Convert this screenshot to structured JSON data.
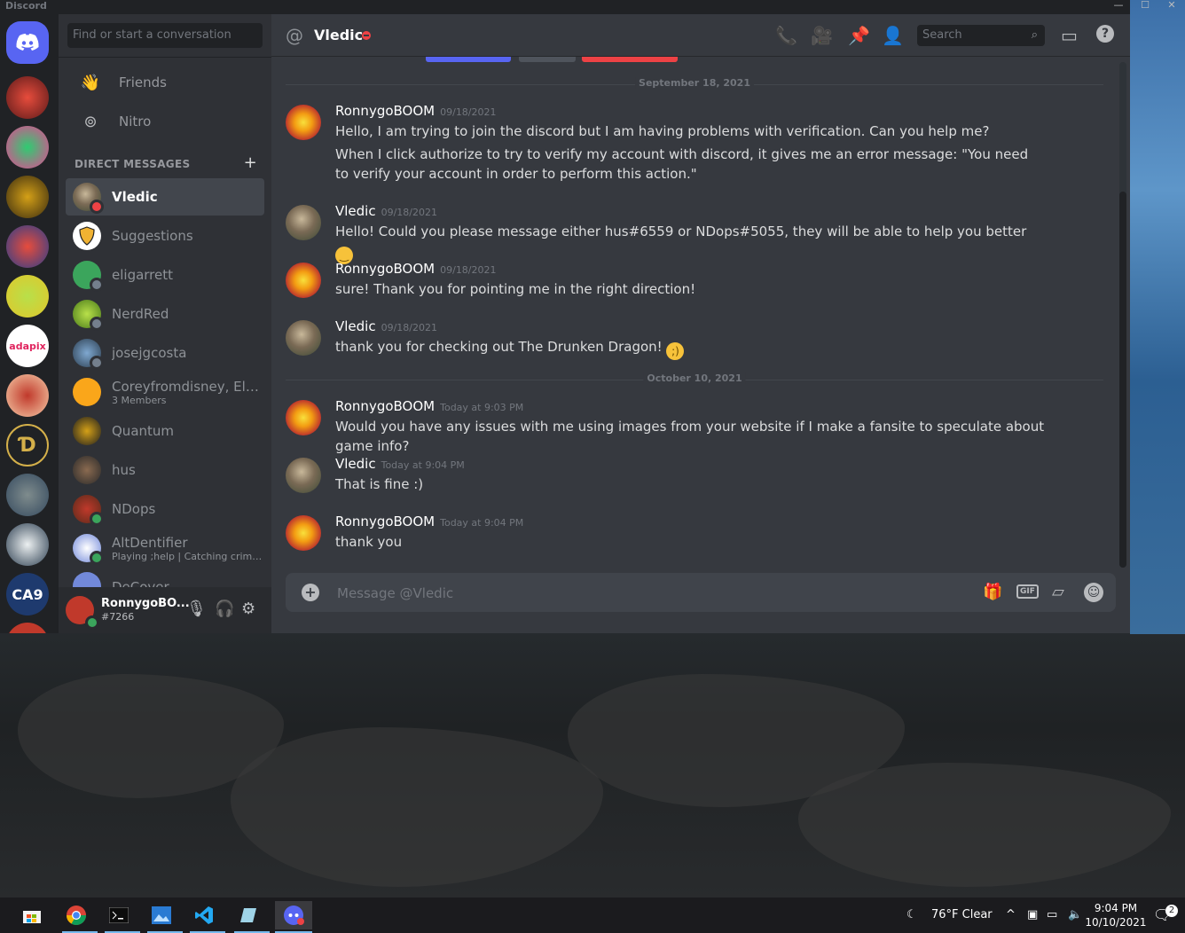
{
  "app": {
    "title": "Discord"
  },
  "window_controls": {
    "minimize": "—",
    "maximize": "☐",
    "close": "✕"
  },
  "dm_sidebar": {
    "search_placeholder": "Find or start a conversation",
    "nav": [
      {
        "label": "Friends",
        "icon": "friends-icon"
      },
      {
        "label": "Nitro",
        "icon": "nitro-icon"
      }
    ],
    "section_title": "DIRECT MESSAGES",
    "add_label": "+",
    "items": [
      {
        "name": "Vledic",
        "status": "dnd",
        "active": true
      },
      {
        "name": "Suggestions"
      },
      {
        "name": "eligarrett",
        "status": "offline"
      },
      {
        "name": "NerdRed",
        "status": "offline"
      },
      {
        "name": "josejgcosta",
        "status": "offline"
      },
      {
        "name": "Coreyfromdisney, Eld...",
        "sub": "3 Members"
      },
      {
        "name": "Quantum"
      },
      {
        "name": "hus"
      },
      {
        "name": "NDops",
        "status": "online"
      },
      {
        "name": "AltDentifier",
        "sub": "Playing ;help | Catching crimi...",
        "status": "online"
      },
      {
        "name": "DeCover"
      }
    ]
  },
  "servers": [
    {
      "label": "adapix",
      "color": "#ffffff",
      "text_color": "#e0245e"
    },
    {
      "label": "CA9",
      "color": "#1e3a6e",
      "text_color": "#ffffff"
    }
  ],
  "user_panel": {
    "username": "RonnygoBO...",
    "tag": "#7266",
    "status": "online"
  },
  "chat_header": {
    "title": "Vledic",
    "search_placeholder": "Search"
  },
  "dividers": [
    "September 18, 2021",
    "October 10, 2021"
  ],
  "messages": [
    {
      "author": "RonnygoBOOM",
      "time": "09/18/2021",
      "lines": [
        "Hello, I am trying to join the discord but I am having problems with verification. Can you help me?",
        "When I click authorize to try to verify my account with discord, it gives me an error message: \"You need to verify your account in order to perform this action.\""
      ]
    },
    {
      "author": "Vledic",
      "time": "09/18/2021",
      "lines": [
        "Hello! Could you please message either hus#6559 or NDops#5055, they will be able to help you better"
      ],
      "emoji": "slight-smile-emoji"
    },
    {
      "author": "RonnygoBOOM",
      "time": "09/18/2021",
      "lines": [
        "sure! Thank you for pointing me in the right direction!"
      ]
    },
    {
      "author": "Vledic",
      "time": "09/18/2021",
      "lines": [
        "thank you for checking out The Drunken Dragon!"
      ],
      "emoji": "wink-emoji"
    },
    {
      "author": "RonnygoBOOM",
      "time": "Today at 9:03 PM",
      "lines": [
        "Would you have any issues with me using images from your website if I make a fansite to speculate about game info?"
      ]
    },
    {
      "author": "Vledic",
      "time": "Today at 9:04 PM",
      "lines": [
        "That is fine :)"
      ]
    },
    {
      "author": "RonnygoBOOM",
      "time": "Today at 9:04 PM",
      "lines": [
        "thank you"
      ]
    }
  ],
  "composer": {
    "placeholder": "Message @Vledic",
    "gif_label": "GIF"
  },
  "taskbar": {
    "weather": "76°F  Clear",
    "time": "9:04 PM",
    "date": "10/10/2021",
    "notifications": "2"
  },
  "colors": {
    "blurple": "#5865f2",
    "dnd": "#ed4245",
    "online": "#3ba55c",
    "offline": "#747f8d"
  }
}
